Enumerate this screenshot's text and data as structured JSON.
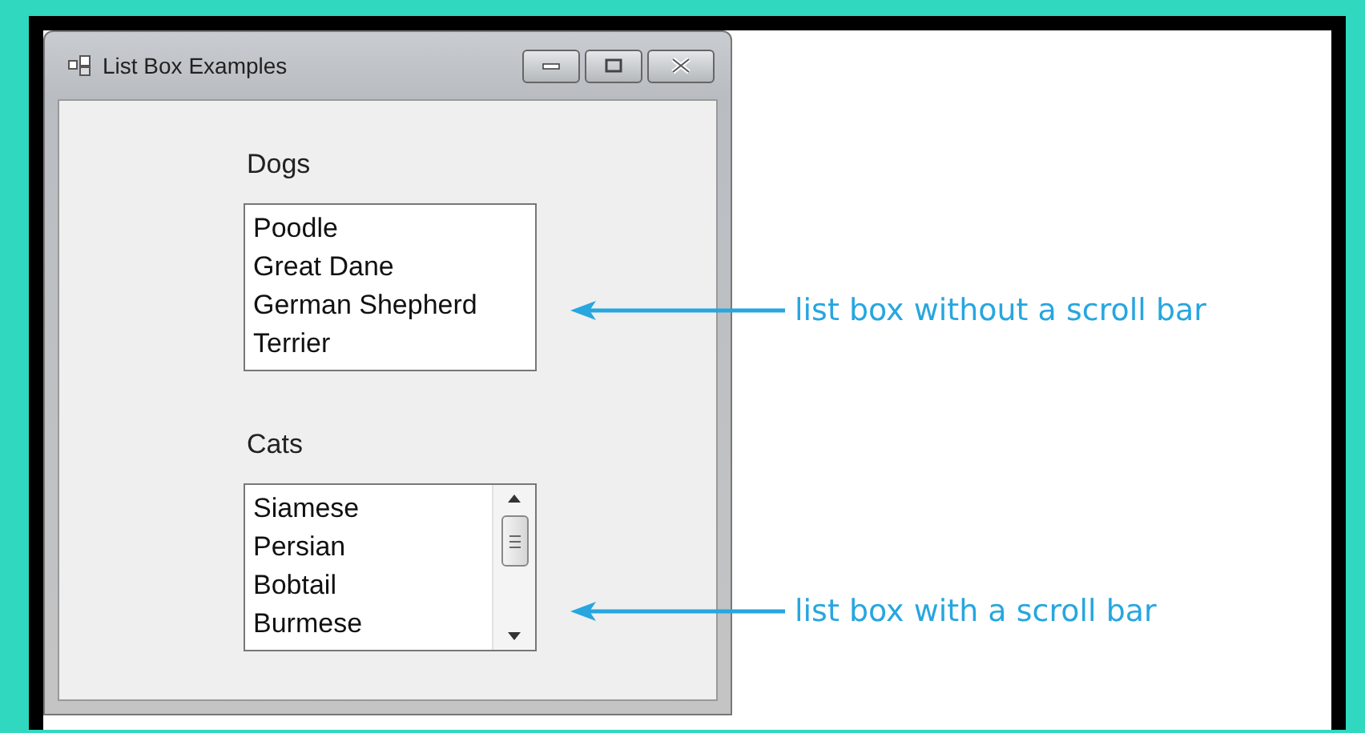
{
  "window": {
    "title": "List Box Examples"
  },
  "list_boxes": [
    {
      "label": "Dogs",
      "items": [
        "Poodle",
        "Great Dane",
        "German Shepherd",
        "Terrier"
      ],
      "scroll_bar": false
    },
    {
      "label": "Cats",
      "items": [
        "Siamese",
        "Persian",
        "Bobtail",
        "Burmese"
      ],
      "scroll_bar": true
    }
  ],
  "callouts": [
    {
      "text": "list box without a scroll bar"
    },
    {
      "text": "list box with a scroll bar"
    }
  ]
}
